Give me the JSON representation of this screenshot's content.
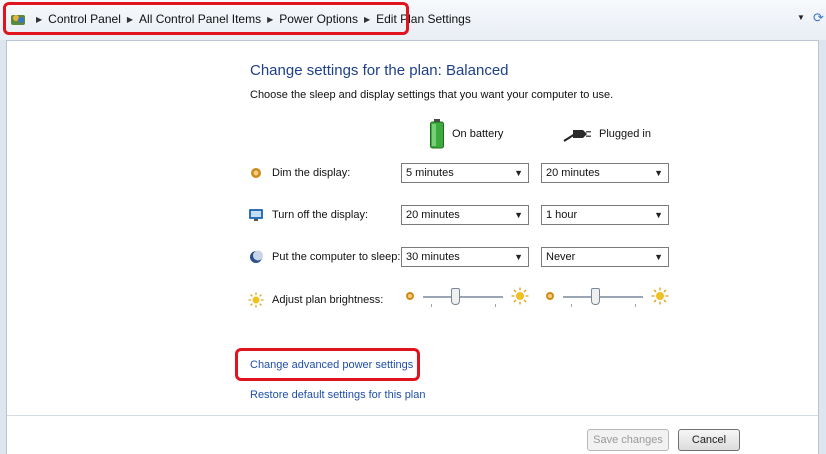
{
  "address_bar": {
    "crumbs": [
      "Control Panel",
      "All Control Panel Items",
      "Power Options",
      "Edit Plan Settings"
    ]
  },
  "main": {
    "title": "Change settings for the plan: Balanced",
    "subtitle": "Choose the sleep and display settings that you want your computer to use.",
    "columns": {
      "battery": "On battery",
      "plugged": "Plugged in"
    },
    "rows": {
      "dim": {
        "label": "Dim the display:",
        "battery": "5 minutes",
        "plugged": "20 minutes"
      },
      "display_off": {
        "label": "Turn off the display:",
        "battery": "20 minutes",
        "plugged": "1 hour"
      },
      "sleep": {
        "label": "Put the computer to sleep:",
        "battery": "30 minutes",
        "plugged": "Never"
      },
      "brightness": {
        "label": "Adjust plan brightness:",
        "battery_level": 0.4,
        "plugged_level": 0.4
      }
    },
    "links": {
      "advanced": "Change advanced power settings",
      "restore": "Restore default settings for this plan"
    },
    "buttons": {
      "save": "Save changes",
      "cancel": "Cancel"
    }
  },
  "icons": {
    "address": "control-panel-icon",
    "refresh": "refresh-icon",
    "battery": "battery-icon",
    "plug": "plug-icon",
    "dim": "dim-display-icon",
    "display_off": "monitor-icon",
    "sleep": "moon-icon",
    "brightness": "sun-icon"
  },
  "colors": {
    "highlight": "#e0141e",
    "link": "#1f4ea8",
    "title": "#1e3f8a"
  }
}
